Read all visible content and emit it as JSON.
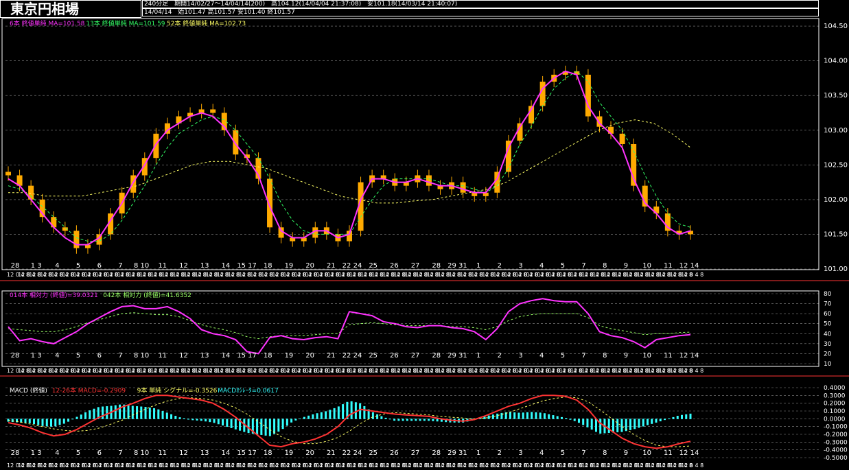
{
  "header": {
    "title": "東京円相場",
    "period_label": "240分足",
    "period": "期間14/02/27〜14/04/14(200)",
    "high": "高104.12(14/04/04 21:37:08)",
    "low": "安101.18(14/03/14 21:40:07)",
    "date": "14/04/14",
    "ohlc": "始101.47 高101.57 安101.40 終101.57"
  },
  "legends": {
    "main": [
      {
        "text": "6本 終値単純 MA=101.58",
        "color": "#ff33ff"
      },
      {
        "text": "13本 終値単純 MA=101.59",
        "color": "#33ff66"
      },
      {
        "text": "52本 終値単純 MA=102.73",
        "color": "#ffff66"
      }
    ],
    "rsi": [
      {
        "text": "014本 相対力 (終値)=39.0321",
        "color": "#ff33ff"
      },
      {
        "text": "042本 相対力 (終値)=41.6352",
        "color": "#99ff66"
      }
    ],
    "macd": [
      {
        "text": "MACD (終値)",
        "color": "#ffffff"
      },
      {
        "text": "12-26本 MACD=-0.2909",
        "color": "#ff3333"
      },
      {
        "text": "9本 単純 シグナル=-0.3526",
        "color": "#ffff66"
      },
      {
        "text": "MACDｵｼﾚｰﾀ=0.0617",
        "color": "#33ffff"
      }
    ]
  },
  "colors": {
    "candle_up": "#ffaa00",
    "candle_down": "#ffaa00",
    "ma6": "#ff33ff",
    "ma13": "#33ff66",
    "ma52": "#ffff66",
    "rsi14": "#ff33ff",
    "rsi42": "#99ff66",
    "macd": "#ff3333",
    "signal": "#ffff66",
    "histogram": "#33ffff",
    "grid": "#ffffff"
  },
  "chart_data": [
    {
      "type": "candlestick",
      "title": "東京円相場",
      "ylim": [
        101.0,
        104.6
      ],
      "y_ticks": [
        "104.50",
        "104.00",
        "103.50",
        "103.00",
        "102.50",
        "102.00",
        "101.50",
        "101.00"
      ],
      "x_ticks": [
        "28",
        "1 3",
        "4",
        "5",
        "6",
        "7",
        "8 10",
        "11",
        "12",
        "13",
        "14",
        "15 17",
        "18",
        "19",
        "20",
        "21",
        "22 24",
        "25",
        "26",
        "27",
        "28",
        "29 31",
        "1",
        "2",
        "3",
        "4",
        "5",
        "7",
        "8",
        "9",
        "10",
        "11",
        "12 14"
      ],
      "time_row": "12 0 4 8",
      "close_series": [
        102.35,
        102.2,
        102.0,
        101.75,
        101.6,
        101.55,
        101.3,
        101.35,
        101.5,
        101.8,
        102.1,
        102.35,
        102.6,
        102.95,
        103.1,
        103.2,
        103.25,
        103.3,
        103.25,
        103.0,
        102.65,
        102.6,
        102.3,
        101.6,
        101.45,
        101.4,
        101.45,
        101.6,
        101.5,
        101.4,
        101.55,
        102.25,
        102.35,
        102.3,
        102.2,
        102.25,
        102.35,
        102.2,
        102.15,
        102.25,
        102.1,
        102.05,
        102.1,
        102.4,
        102.85,
        103.1,
        103.35,
        103.7,
        103.8,
        103.85,
        103.8,
        103.2,
        103.05,
        102.95,
        102.8,
        102.2,
        101.9,
        101.8,
        101.55,
        101.5,
        101.55
      ],
      "ma6_series": [
        102.3,
        102.2,
        102.0,
        101.8,
        101.6,
        101.45,
        101.35,
        101.35,
        101.45,
        101.7,
        101.95,
        102.25,
        102.5,
        102.8,
        103.0,
        103.1,
        103.2,
        103.25,
        103.2,
        103.05,
        102.8,
        102.6,
        102.35,
        101.9,
        101.55,
        101.45,
        101.45,
        101.55,
        101.55,
        101.45,
        101.5,
        102.0,
        102.3,
        102.3,
        102.25,
        102.25,
        102.3,
        102.25,
        102.2,
        102.2,
        102.15,
        102.1,
        102.1,
        102.3,
        102.75,
        103.05,
        103.3,
        103.6,
        103.75,
        103.85,
        103.8,
        103.35,
        103.1,
        102.95,
        102.75,
        102.3,
        101.95,
        101.8,
        101.6,
        101.5,
        101.55
      ],
      "ma13_series": [
        102.2,
        102.15,
        102.05,
        101.9,
        101.75,
        101.6,
        101.45,
        101.4,
        101.4,
        101.5,
        101.7,
        101.95,
        102.2,
        102.5,
        102.75,
        102.95,
        103.05,
        103.15,
        103.2,
        103.15,
        103.0,
        102.8,
        102.6,
        102.3,
        101.95,
        101.7,
        101.55,
        101.5,
        101.5,
        101.5,
        101.5,
        101.75,
        102.0,
        102.2,
        102.3,
        102.3,
        102.3,
        102.3,
        102.25,
        102.2,
        102.2,
        102.15,
        102.1,
        102.2,
        102.45,
        102.8,
        103.05,
        103.35,
        103.6,
        103.75,
        103.85,
        103.7,
        103.4,
        103.2,
        103.0,
        102.7,
        102.35,
        102.05,
        101.8,
        101.65,
        101.6
      ],
      "ma52_series": [
        102.1,
        102.1,
        102.05,
        102.05,
        102.05,
        102.1,
        102.15,
        102.2,
        102.3,
        102.4,
        102.5,
        102.55,
        102.55,
        102.5,
        102.45,
        102.35,
        102.25,
        102.15,
        102.05,
        102.0,
        101.95,
        101.95,
        101.98,
        102.0,
        102.05,
        102.1,
        102.15,
        102.25,
        102.4,
        102.55,
        102.7,
        102.85,
        103.0,
        103.1,
        103.15,
        103.1,
        102.95,
        102.75
      ]
    },
    {
      "type": "line",
      "title": "相対力",
      "ylim": [
        10,
        80
      ],
      "y_ticks": [
        "80",
        "70",
        "60",
        "50",
        "40",
        "30",
        "20",
        "10"
      ],
      "series": [
        {
          "name": "014本 相対力 (終値)",
          "values": [
            47,
            33,
            35,
            32,
            30,
            36,
            42,
            50,
            56,
            62,
            67,
            68,
            65,
            65,
            67,
            62,
            55,
            44,
            40,
            38,
            34,
            22,
            20,
            36,
            38,
            35,
            34,
            36,
            37,
            35,
            62,
            60,
            58,
            52,
            50,
            47,
            46,
            48,
            48,
            46,
            45,
            42,
            34,
            45,
            62,
            70,
            73,
            75,
            73,
            72,
            72,
            60,
            42,
            38,
            36,
            32,
            26,
            34,
            36,
            38,
            39
          ]
        },
        {
          "name": "042本 相対力 (終値)",
          "values": [
            45,
            44,
            43,
            42,
            42,
            44,
            47,
            51,
            54,
            57,
            60,
            61,
            60,
            59,
            59,
            57,
            53,
            49,
            46,
            44,
            41,
            37,
            35,
            37,
            38,
            38,
            38,
            39,
            40,
            40,
            49,
            50,
            51,
            50,
            49,
            48,
            48,
            48,
            48,
            47,
            47,
            46,
            44,
            47,
            53,
            57,
            59,
            60,
            60,
            60,
            60,
            56,
            48,
            45,
            43,
            41,
            39,
            40,
            40,
            41,
            41.6
          ]
        }
      ]
    },
    {
      "type": "line",
      "title": "MACD (終値)",
      "ylim": [
        -0.5,
        0.4
      ],
      "y_ticks": [
        "0.4000",
        "0.3000",
        "0.2000",
        "0.1000",
        "0.0000",
        "-0.1000",
        "-0.2000",
        "-0.3000",
        "-0.4000",
        "-0.5000"
      ],
      "series": [
        {
          "name": "12-26本 MACD",
          "values": [
            -0.05,
            -0.08,
            -0.12,
            -0.18,
            -0.22,
            -0.2,
            -0.14,
            -0.06,
            0.02,
            0.08,
            0.15,
            0.2,
            0.26,
            0.3,
            0.3,
            0.28,
            0.26,
            0.24,
            0.2,
            0.12,
            0.02,
            -0.1,
            -0.22,
            -0.34,
            -0.36,
            -0.32,
            -0.3,
            -0.26,
            -0.2,
            -0.1,
            0.05,
            0.12,
            0.1,
            0.08,
            0.06,
            0.05,
            0.04,
            0.03,
            0.0,
            -0.02,
            -0.03,
            -0.01,
            0.04,
            0.1,
            0.16,
            0.2,
            0.26,
            0.3,
            0.3,
            0.29,
            0.24,
            0.12,
            -0.05,
            -0.15,
            -0.25,
            -0.32,
            -0.36,
            -0.38,
            -0.36,
            -0.32,
            -0.29
          ]
        },
        {
          "name": "9本 単純 シグナル",
          "values": [
            -0.02,
            -0.04,
            -0.07,
            -0.1,
            -0.13,
            -0.15,
            -0.16,
            -0.15,
            -0.12,
            -0.07,
            -0.02,
            0.05,
            0.12,
            0.18,
            0.23,
            0.26,
            0.27,
            0.26,
            0.24,
            0.2,
            0.14,
            0.06,
            -0.04,
            -0.14,
            -0.23,
            -0.29,
            -0.32,
            -0.32,
            -0.29,
            -0.24,
            -0.16,
            -0.06,
            0.02,
            0.06,
            0.08,
            0.07,
            0.06,
            0.05,
            0.03,
            0.02,
            0.01,
            0.0,
            0.01,
            0.04,
            0.08,
            0.13,
            0.18,
            0.23,
            0.26,
            0.28,
            0.27,
            0.22,
            0.12,
            0.01,
            -0.1,
            -0.2,
            -0.28,
            -0.34,
            -0.36,
            -0.36,
            -0.35
          ]
        }
      ]
    }
  ]
}
